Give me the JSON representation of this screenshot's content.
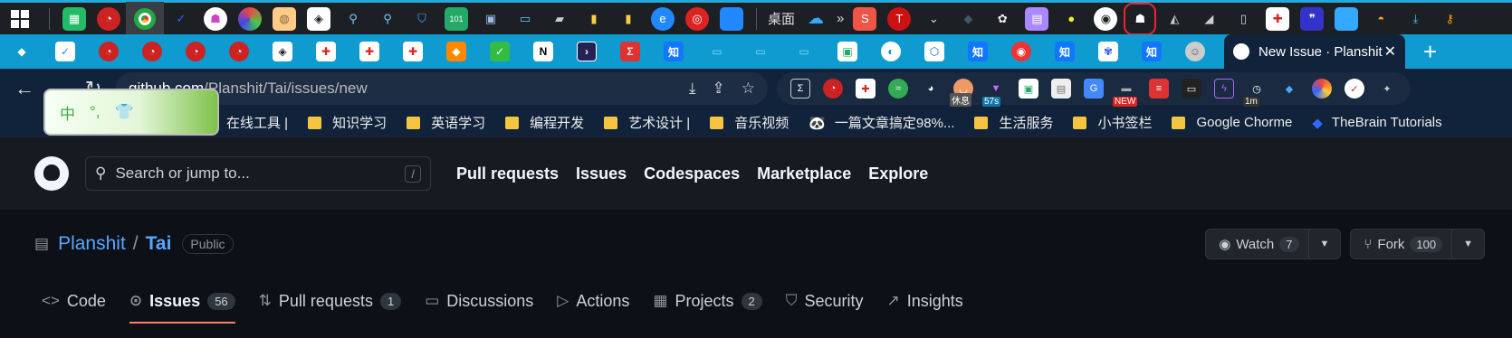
{
  "taskbar": {
    "desktop_label": "桌面",
    "overflow": "»",
    "icons": [
      "photos-icon",
      "speed-icon",
      "chrome-icon",
      "todo-icon",
      "ghost-icon",
      "circle-icon",
      "notes-icon",
      "wolf-icon",
      "magnifier-icon",
      "magnifier2-icon",
      "shield-icon",
      "calculator-icon",
      "floppy-icon",
      "laptop-icon",
      "printer-icon",
      "bookmark-icon",
      "bookmark2-icon",
      "edge-icon",
      "netease-icon",
      "square-icon"
    ],
    "tray_icons": [
      "sogou-icon",
      "red-icon",
      "chevron-icon",
      "cat-icon",
      "brain-icon",
      "purple-icon",
      "yellow-icon",
      "clock-icon",
      "ghost-tray-icon",
      "cat2-icon",
      "wolf2-icon",
      "mouse-icon",
      "plus-icon",
      "quote-icon",
      "blue-icon",
      "fox-icon",
      "download-icon",
      "key-icon"
    ]
  },
  "tabs": {
    "favicons": [
      "crystal-icon",
      "check-icon",
      "speed-icon",
      "speed-icon",
      "speed-icon",
      "speed-icon",
      "wolf-icon",
      "plus-icon",
      "plus-icon",
      "plus-icon",
      "flame-icon",
      "green-check-icon",
      "notion-icon",
      "terminal-icon",
      "sigma-icon",
      "zhihu-icon",
      "tv-icon",
      "tv-icon",
      "tv-icon",
      "sheet-icon",
      "drop-icon",
      "box-icon",
      "zhihu-icon",
      "weibo-icon",
      "zhihu-icon",
      "paw-icon",
      "zhihu-icon",
      "robot-icon"
    ],
    "active": {
      "title": "New Issue · Planshit",
      "close": "✕"
    },
    "new_tab": "+"
  },
  "address": {
    "host": "github.com",
    "path": "/Planshit/Tai/issues/new",
    "extension_badges": [
      "休息",
      "57s",
      "NEW",
      "1m"
    ]
  },
  "ime": {
    "label_zh": "中",
    "punct": "°,",
    "shirt": "👕"
  },
  "bookmarks": [
    {
      "label": "在线工具 |",
      "icon": "folder"
    },
    {
      "label": "知识学习",
      "icon": "folder"
    },
    {
      "label": "英语学习",
      "icon": "folder"
    },
    {
      "label": "编程开发",
      "icon": "folder"
    },
    {
      "label": "艺术设计 |",
      "icon": "folder"
    },
    {
      "label": "音乐视频",
      "icon": "folder"
    },
    {
      "label": "一篇文章搞定98%...",
      "icon": "panda"
    },
    {
      "label": "生活服务",
      "icon": "folder"
    },
    {
      "label": "小书签栏",
      "icon": "folder"
    },
    {
      "label": "Google Chorme",
      "icon": "folder"
    },
    {
      "label": "TheBrain Tutorials",
      "icon": "brain"
    }
  ],
  "github": {
    "search_placeholder": "Search or jump to...",
    "search_key": "/",
    "nav": [
      "Pull requests",
      "Issues",
      "Codespaces",
      "Marketplace",
      "Explore"
    ]
  },
  "repo": {
    "owner": "Planshit",
    "separator": "/",
    "name": "Tai",
    "visibility": "Public",
    "watch_label": "Watch",
    "watch_count": "7",
    "fork_label": "Fork",
    "fork_count": "100"
  },
  "repo_tabs": [
    {
      "label": "Code",
      "icon": "<>",
      "count": ""
    },
    {
      "label": "Issues",
      "icon": "⊙",
      "count": "56",
      "selected": true
    },
    {
      "label": "Pull requests",
      "icon": "⇅",
      "count": "1"
    },
    {
      "label": "Discussions",
      "icon": "▭",
      "count": ""
    },
    {
      "label": "Actions",
      "icon": "▷",
      "count": ""
    },
    {
      "label": "Projects",
      "icon": "▦",
      "count": "2"
    },
    {
      "label": "Security",
      "icon": "⛉",
      "count": ""
    },
    {
      "label": "Insights",
      "icon": "↗",
      "count": ""
    }
  ],
  "colors": {
    "taskbar": "#1c1f24",
    "tabstrip": "#0f9ad0",
    "chrome_dark": "#11233a",
    "gh_header": "#161b22",
    "gh_bg": "#0d1117",
    "link": "#58a6ff",
    "tab_underline": "#f78166"
  }
}
